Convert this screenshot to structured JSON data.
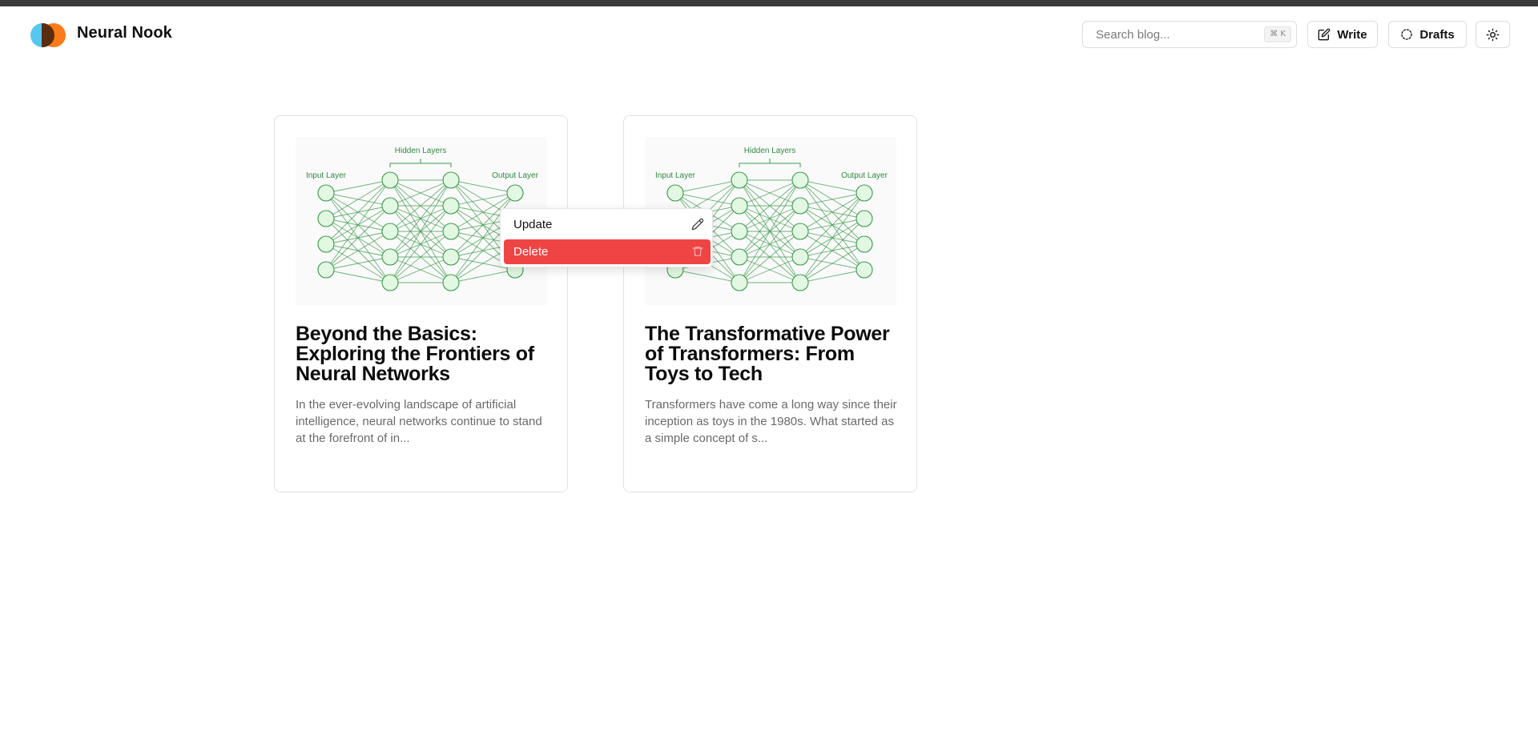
{
  "app": {
    "name": "Neural Nook"
  },
  "header": {
    "search_placeholder": "Search blog...",
    "search_shortcut": "⌘ K",
    "write_label": "Write",
    "drafts_label": "Drafts"
  },
  "posts": [
    {
      "title": "Beyond the Basics: Exploring the Frontiers of Neural Networks",
      "excerpt": "In the ever-evolving landscape of artificial intelligence, neural networks continue to stand at the forefront of in...",
      "image": {
        "hidden_label": "Hidden Layers",
        "input_label": "Input Layer",
        "output_label": "Output Layer"
      }
    },
    {
      "title": "The Transformative Power of Transformers: From Toys to Tech",
      "excerpt": "Transformers have come a long way since their inception as toys in the 1980s. What started as a simple concept of s...",
      "image": {
        "hidden_label": "Hidden Layers",
        "input_label": "Input Layer",
        "output_label": "Output Layer"
      }
    }
  ],
  "context_menu": {
    "update_label": "Update",
    "delete_label": "Delete"
  },
  "colors": {
    "brand_blue": "#56c8ee",
    "brand_orange": "#fb7a1a",
    "danger": "#ef4444",
    "nn_stroke": "#3a9a4a",
    "nn_fill": "#e3f8e3"
  }
}
